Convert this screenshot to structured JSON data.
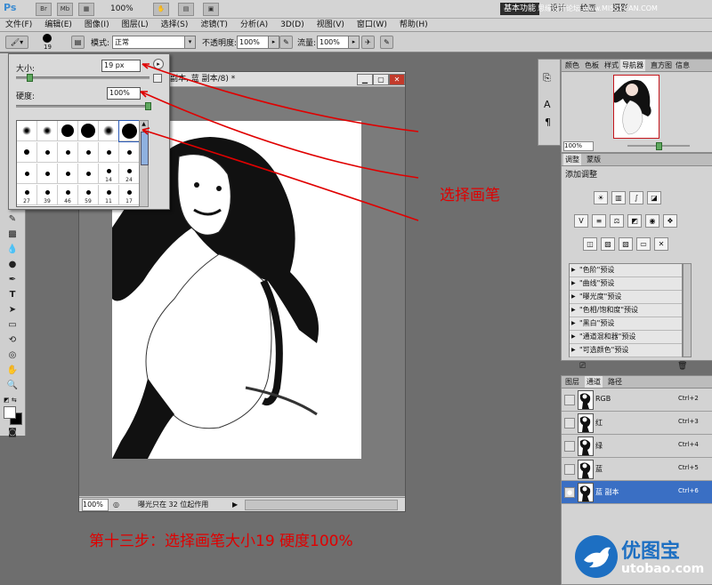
{
  "app": {
    "logo": "Ps",
    "zoom": "100%",
    "workspace": [
      "基本功能",
      "设计",
      "绘画",
      "摄影"
    ],
    "watermark_top": "思缘设计论坛 www.MISSYUAN.COM"
  },
  "menu": [
    "文件(F)",
    "编辑(E)",
    "图像(I)",
    "图层(L)",
    "选择(S)",
    "滤镜(T)",
    "分析(A)",
    "3D(D)",
    "视图(V)",
    "窗口(W)",
    "帮助(H)"
  ],
  "options": {
    "brush_size": "19",
    "mode_label": "模式:",
    "mode_value": "正常",
    "opacity_label": "不透明度:",
    "opacity_value": "100%",
    "flow_label": "流量:",
    "flow_value": "100%"
  },
  "brush_picker": {
    "size_label": "大小:",
    "size_value": "19 px",
    "size_fraction": 0.1,
    "hardness_label": "硬度:",
    "hardness_value": "100%",
    "hardness_fraction": 1.0,
    "presets": [
      {
        "label": "",
        "dot": 10,
        "soft": true
      },
      {
        "label": "",
        "dot": 10,
        "soft": true
      },
      {
        "label": "",
        "dot": 14,
        "soft": false
      },
      {
        "label": "",
        "dot": 16,
        "soft": false
      },
      {
        "label": "",
        "dot": 12,
        "soft": true
      },
      {
        "label": "",
        "dot": 17,
        "soft": false
      },
      {
        "label": "",
        "dot": 6,
        "soft": false
      },
      {
        "label": "",
        "dot": 5,
        "soft": false
      },
      {
        "label": "",
        "dot": 5,
        "soft": false
      },
      {
        "label": "",
        "dot": 5,
        "soft": false
      },
      {
        "label": "",
        "dot": 5,
        "soft": false
      },
      {
        "label": "",
        "dot": 5,
        "soft": false
      },
      {
        "label": "",
        "dot": 5,
        "soft": false
      },
      {
        "label": "",
        "dot": 5,
        "soft": false
      },
      {
        "label": "",
        "dot": 5,
        "soft": false
      },
      {
        "label": "",
        "dot": 5,
        "soft": false
      },
      {
        "label": "14",
        "dot": 5,
        "soft": false
      },
      {
        "label": "24",
        "dot": 5,
        "soft": false
      },
      {
        "label": "27",
        "dot": 5,
        "soft": false
      },
      {
        "label": "39",
        "dot": 5,
        "soft": false
      },
      {
        "label": "46",
        "dot": 5,
        "soft": false
      },
      {
        "label": "59",
        "dot": 5,
        "soft": false
      },
      {
        "label": "11",
        "dot": 5,
        "soft": false
      },
      {
        "label": "17",
        "dot": 5,
        "soft": false
      }
    ]
  },
  "document": {
    "title": "副本, 蓝 副本/8) *",
    "zoom": "100%",
    "status": "曝光只在 32 位起作用"
  },
  "nav_panel": {
    "tabs": [
      "颜色",
      "色板",
      "样式",
      "导航器",
      "直方图",
      "信息"
    ],
    "active_tab": 3,
    "zoom": "100%"
  },
  "adjustments": {
    "tabs": [
      "调整",
      "蒙版"
    ],
    "title": "添加调整",
    "presets": [
      "\"色阶\"预设",
      "\"曲线\"预设",
      "\"曝光度\"预设",
      "\"色相/饱和度\"预设",
      "\"黑白\"预设",
      "\"通道混和器\"预设",
      "\"可选颜色\"预设"
    ]
  },
  "channels": {
    "tabs": [
      "图层",
      "通道",
      "路径"
    ],
    "active_tab": 1,
    "rows": [
      {
        "name": "RGB",
        "key": "Ctrl+2",
        "selected": false
      },
      {
        "name": "红",
        "key": "Ctrl+3",
        "selected": false
      },
      {
        "name": "绿",
        "key": "Ctrl+4",
        "selected": false
      },
      {
        "name": "蓝",
        "key": "Ctrl+5",
        "selected": false
      },
      {
        "name": "蓝 副本",
        "key": "Ctrl+6",
        "selected": true
      }
    ]
  },
  "annotations": {
    "select_brush": "选择画笔",
    "step": "第十三步：选择画笔大小19  硬度100%"
  },
  "watermark": {
    "title": "优图宝",
    "url": "utobao.com"
  },
  "colors": {
    "annotation": "#e00000",
    "selection": "#3a6fc4"
  }
}
